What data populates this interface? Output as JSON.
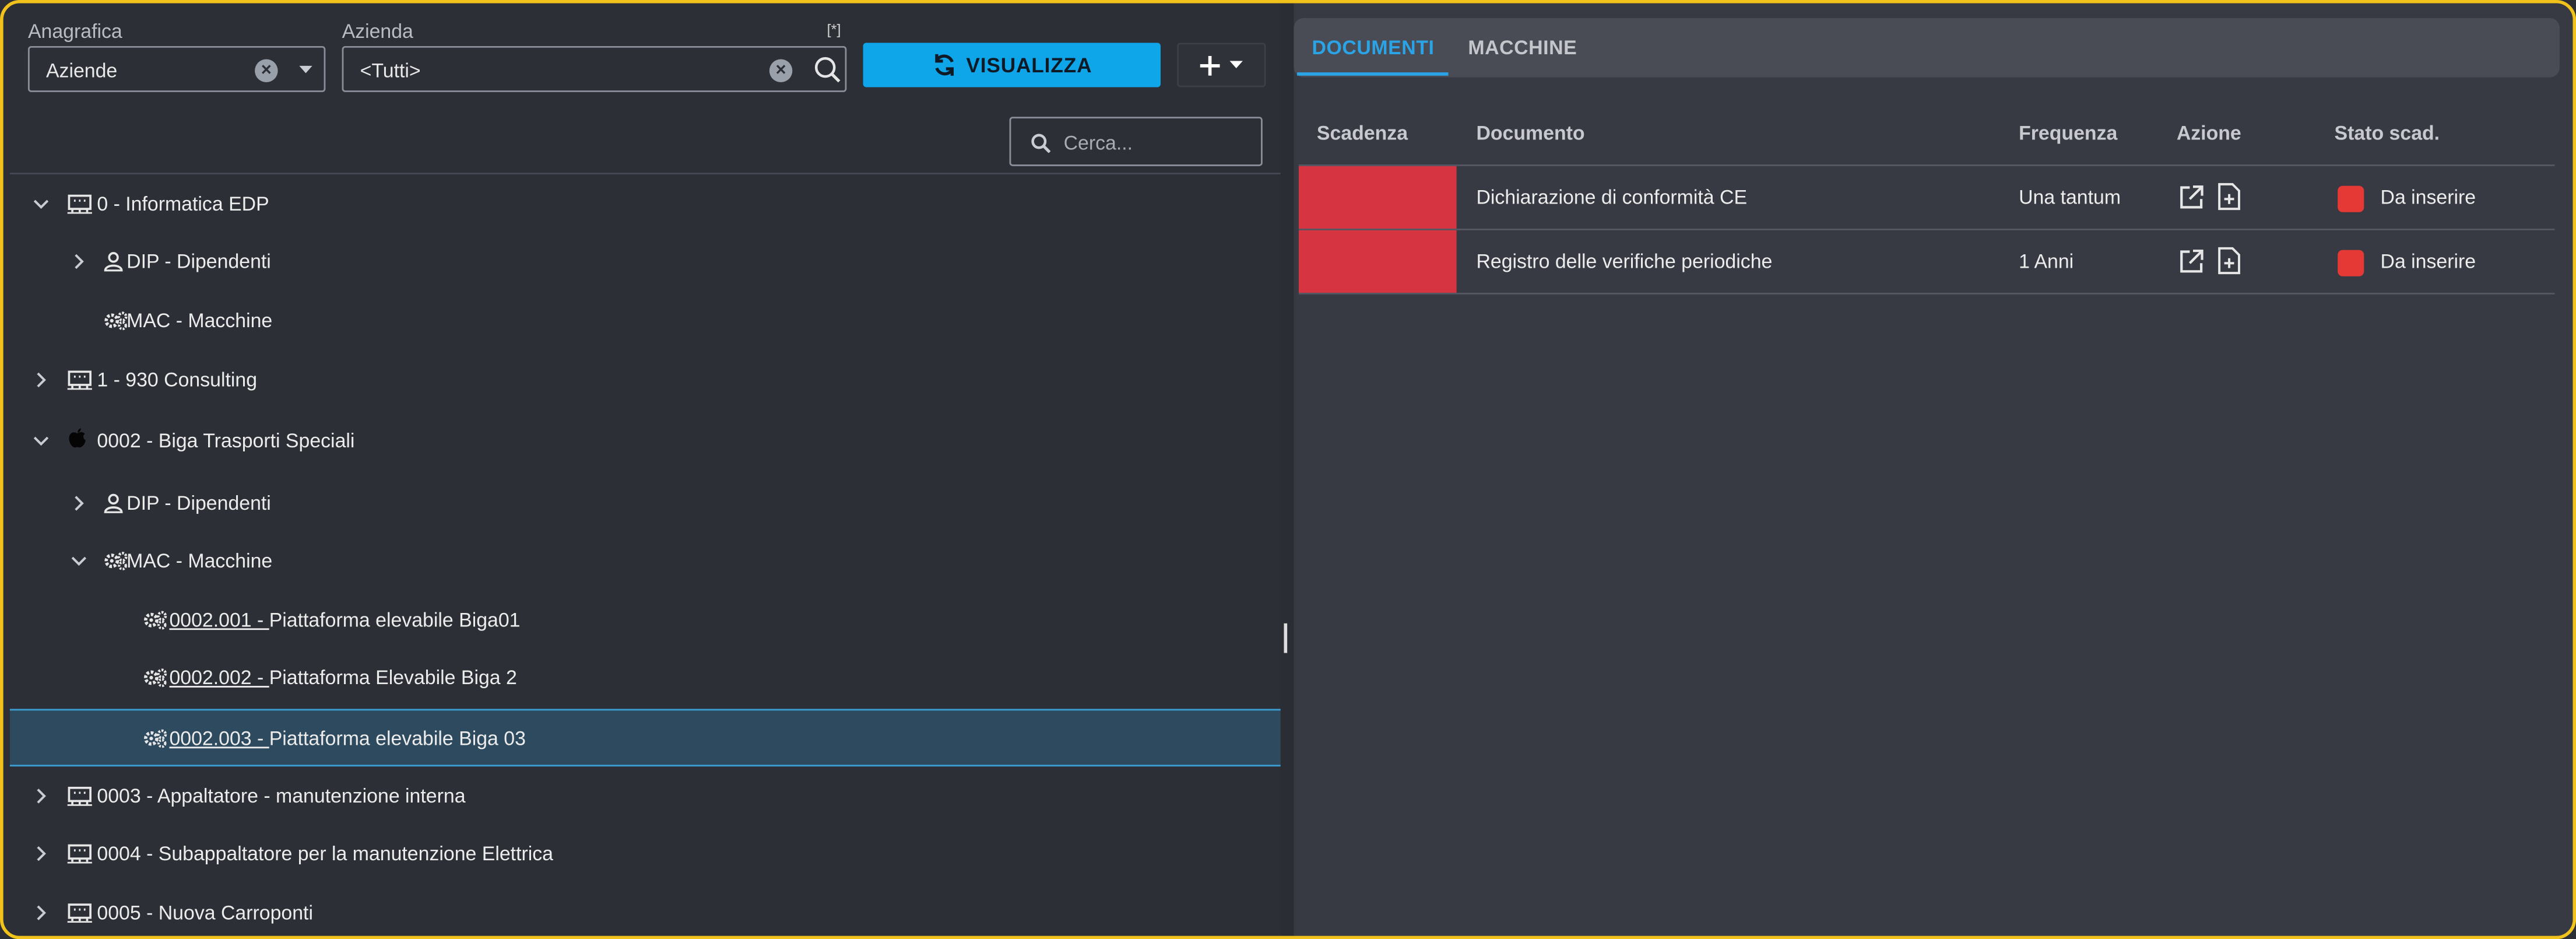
{
  "filters": {
    "anagrafica_label": "Anagrafica",
    "anagrafica_value": "Aziende",
    "azienda_label": "Azienda",
    "azienda_value": "<Tutti>",
    "corner_mark": "[*]",
    "visualizza_label": "VISUALIZZA",
    "search_placeholder": "Cerca..."
  },
  "tree": [
    {
      "label": "0 - Informatica EDP",
      "code": "",
      "icon": "building-icon",
      "expand": "down",
      "level": 0
    },
    {
      "label": "DIP - Dipendenti",
      "code": "",
      "icon": "person-icon",
      "expand": "right",
      "level": 1
    },
    {
      "label": "MAC - Macchine",
      "code": "",
      "icon": "gears-icon",
      "expand": "none",
      "level": 1
    },
    {
      "label": "1 - 930 Consulting",
      "code": "",
      "icon": "building-icon",
      "expand": "right",
      "level": 0
    },
    {
      "label": "0002 - Biga Trasporti Speciali",
      "code": "",
      "icon": "apple-icon",
      "expand": "down",
      "level": 0
    },
    {
      "label": "DIP - Dipendenti",
      "code": "",
      "icon": "person-icon",
      "expand": "right",
      "level": 1
    },
    {
      "label": "MAC - Macchine",
      "code": "",
      "icon": "gears-icon",
      "expand": "down",
      "level": 1
    },
    {
      "label": "Piattaforma elevabile Biga01",
      "code": " 0002.001 - ",
      "icon": "gears-icon",
      "expand": "none",
      "level": 2
    },
    {
      "label": "Piattaforma Elevabile Biga 2",
      "code": " 0002.002 - ",
      "icon": "gears-icon",
      "expand": "none",
      "level": 2
    },
    {
      "label": "Piattaforma elevabile Biga 03",
      "code": " 0002.003 - ",
      "icon": "gears-icon",
      "expand": "none",
      "level": 2,
      "selected": true
    },
    {
      "label": "0003 - Appaltatore - manutenzione interna",
      "code": "",
      "icon": "building-icon",
      "expand": "right",
      "level": 0
    },
    {
      "label": "0004 - Subappaltatore per la manutenzione Elettrica",
      "code": "",
      "icon": "building-icon",
      "expand": "right",
      "level": 0
    },
    {
      "label": "0005 - Nuova Carroponti",
      "code": "",
      "icon": "building-icon",
      "expand": "right",
      "level": 0
    }
  ],
  "tabs": [
    {
      "label": "DOCUMENTI",
      "active": true
    },
    {
      "label": "MACCHINE",
      "active": false
    }
  ],
  "table": {
    "headers": [
      "Scadenza",
      "Documento",
      "Frequenza",
      "Azione",
      "Stato scad."
    ],
    "rows": [
      {
        "documento": "Dichiarazione di conformità CE",
        "frequenza": "Una tantum",
        "stato": "Da inserire"
      },
      {
        "documento": "Registro delle verifiche periodiche",
        "frequenza": "1 Anni",
        "stato": "Da inserire"
      }
    ]
  },
  "colors": {
    "accent": "#0ea5e9",
    "tab_active": "#2aa4e6",
    "scadenza_red": "#d73442",
    "status_red": "#e53935",
    "selected_row": "#2e4a5e"
  }
}
